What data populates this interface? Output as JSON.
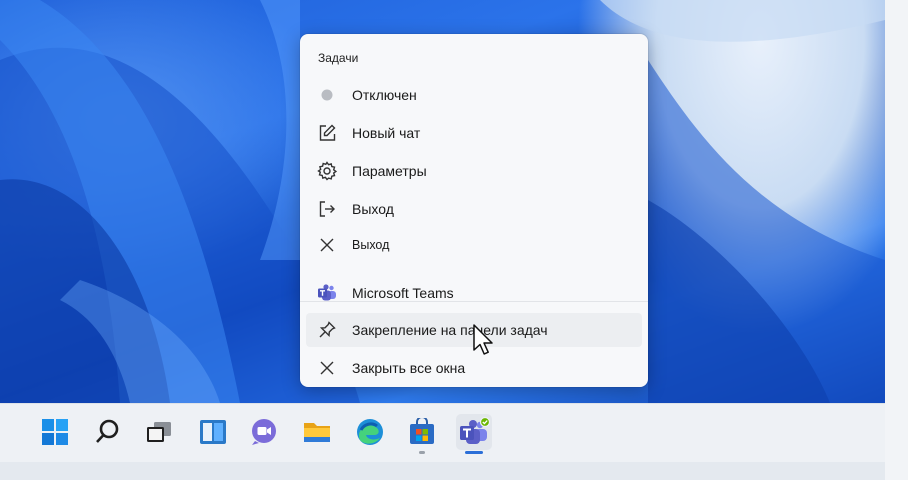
{
  "jumplist": {
    "header": "Задачи",
    "tasks": [
      {
        "label": "Отключен",
        "icon": "status-dot-icon"
      },
      {
        "label": "Новый чат",
        "icon": "compose-icon"
      },
      {
        "label": "Параметры",
        "icon": "gear-icon"
      },
      {
        "label": "Выход",
        "icon": "sign-out-icon"
      },
      {
        "label": "Выход",
        "icon": "close-icon"
      }
    ],
    "app_items": [
      {
        "label": "Microsoft Teams",
        "icon": "teams-icon"
      },
      {
        "label": "Закрепление на панели задач",
        "icon": "pin-icon"
      },
      {
        "label": "Закрыть все окна",
        "icon": "close-icon"
      }
    ]
  },
  "taskbar": {
    "icons": [
      "start-icon",
      "search-icon",
      "task-view-icon",
      "widgets-icon",
      "chat-icon",
      "file-explorer-icon",
      "edge-icon",
      "store-icon",
      "teams-icon"
    ],
    "active": "teams-icon",
    "running": [
      "store-icon",
      "teams-icon"
    ]
  },
  "colors": {
    "accent": "#2b6fd8",
    "teams_purple": "#5b5fc7",
    "menu_bg": "#f7f8fa"
  }
}
